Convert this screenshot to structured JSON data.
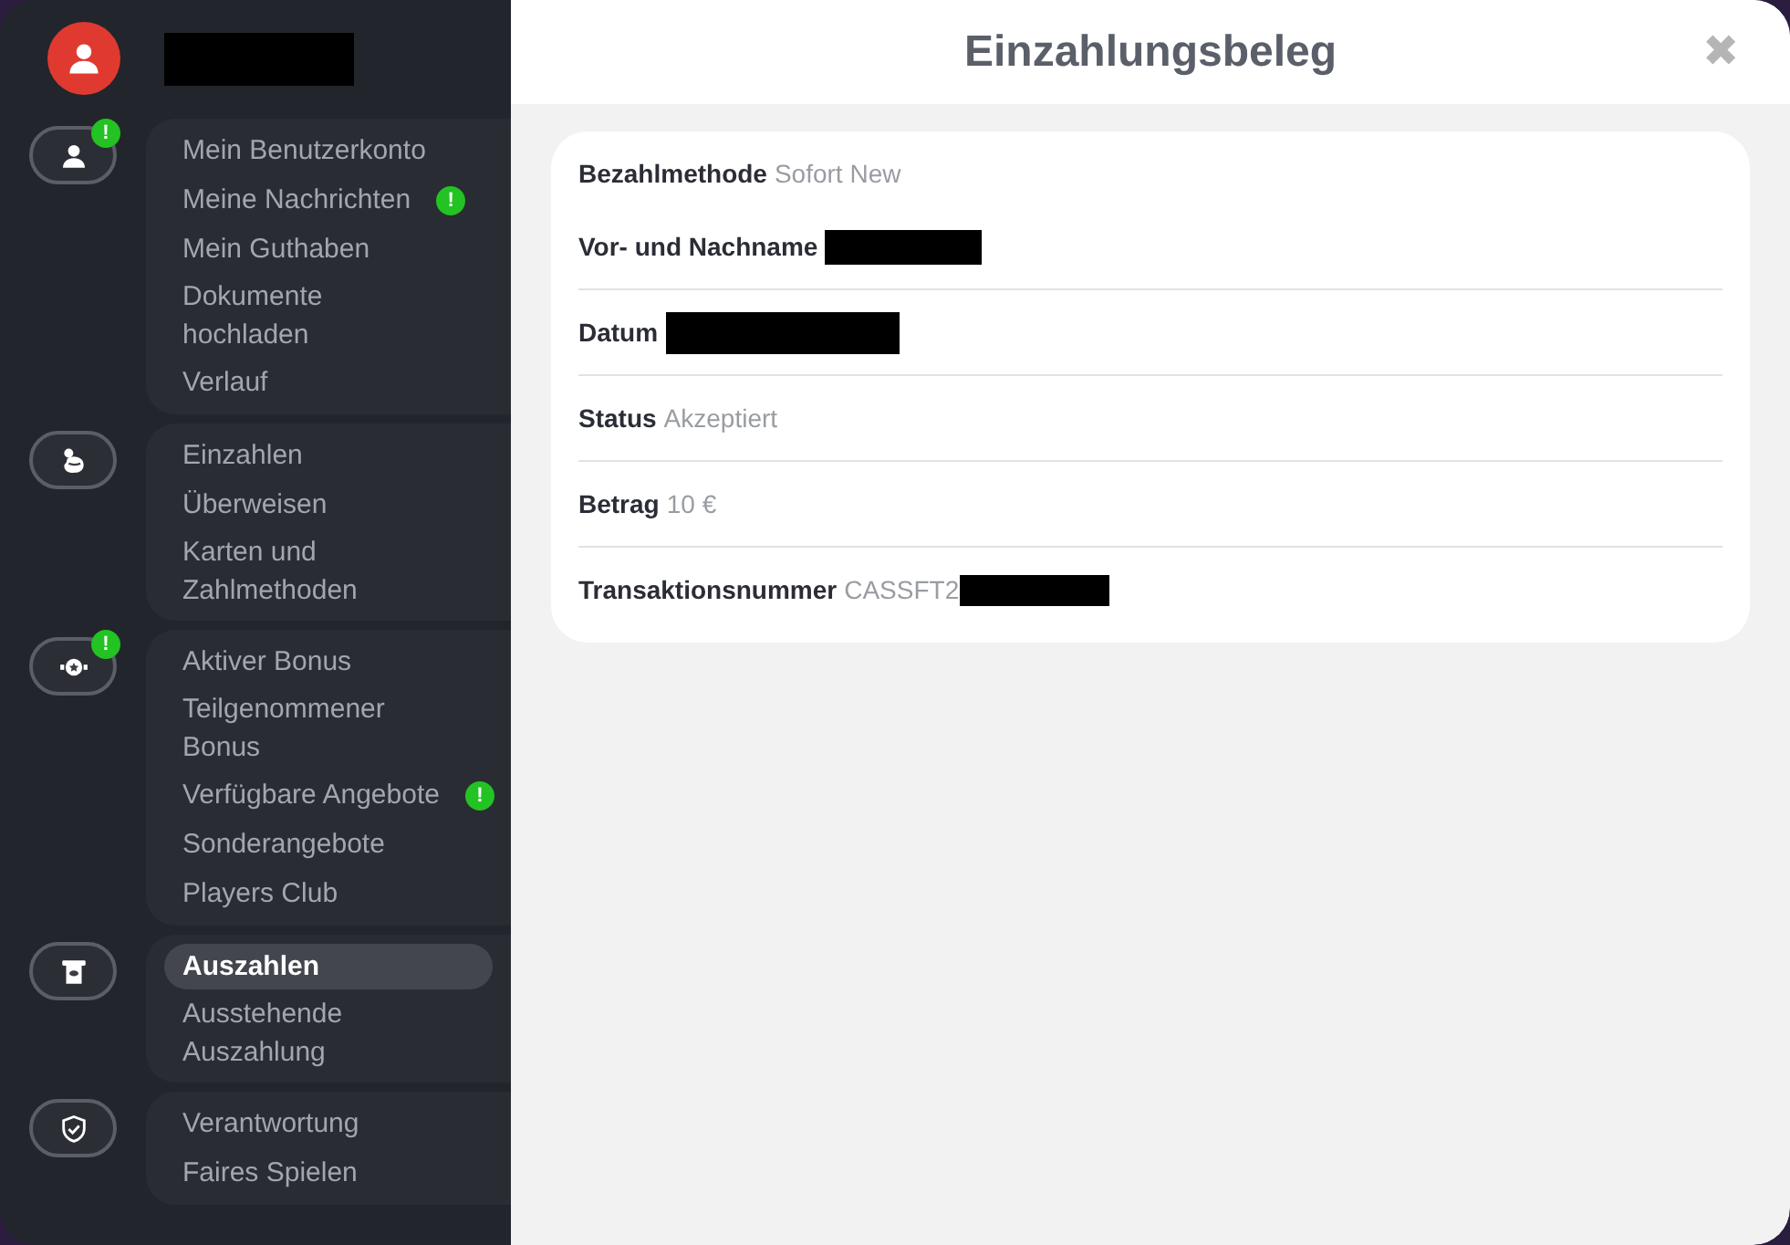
{
  "profile": {
    "name_redacted": true
  },
  "sidebar": {
    "groups": [
      {
        "kind": "user",
        "badge": "!",
        "items": [
          {
            "label": "Mein Benutzerkonto",
            "selected": false
          },
          {
            "label": "Meine Nachrichten",
            "selected": false,
            "badge": "!"
          },
          {
            "label": "Mein Guthaben",
            "selected": false
          },
          {
            "label": "Dokumente hochladen",
            "selected": false
          },
          {
            "label": "Verlauf",
            "selected": false
          }
        ]
      },
      {
        "kind": "deposit",
        "items": [
          {
            "label": "Einzahlen",
            "selected": false
          },
          {
            "label": "Überweisen",
            "selected": false
          },
          {
            "label": "Karten und Zahlmethoden",
            "selected": false
          }
        ]
      },
      {
        "kind": "bonus",
        "badge": "!",
        "items": [
          {
            "label": "Aktiver Bonus",
            "selected": false
          },
          {
            "label": "Teilgenommener Bonus",
            "selected": false
          },
          {
            "label": "Verfügbare Angebote",
            "selected": false,
            "badge": "!"
          },
          {
            "label": "Sonderangebote",
            "selected": false
          },
          {
            "label": "Players Club",
            "selected": false
          }
        ]
      },
      {
        "kind": "withdraw",
        "items": [
          {
            "label": "Auszahlen",
            "selected": true
          },
          {
            "label": "Ausstehende Auszahlung",
            "selected": false
          }
        ]
      },
      {
        "kind": "shield",
        "items": [
          {
            "label": "Verantwortung",
            "selected": false
          },
          {
            "label": "Faires Spielen",
            "selected": false
          }
        ]
      }
    ]
  },
  "dialog": {
    "title": "Einzahlungsbeleg",
    "close": "✖",
    "fields": [
      {
        "label": "Bezahlmethode",
        "value": "Sofort New"
      },
      {
        "label": "Vor- und Nachname",
        "redacted": true
      },
      {
        "label": "Datum",
        "redacted": true
      },
      {
        "label": "Status",
        "value": "Akzeptiert"
      },
      {
        "label": "Betrag",
        "value": "10 €"
      },
      {
        "label": "Transaktionsnummer",
        "value": "CASSFT2",
        "redacted": true
      }
    ]
  }
}
